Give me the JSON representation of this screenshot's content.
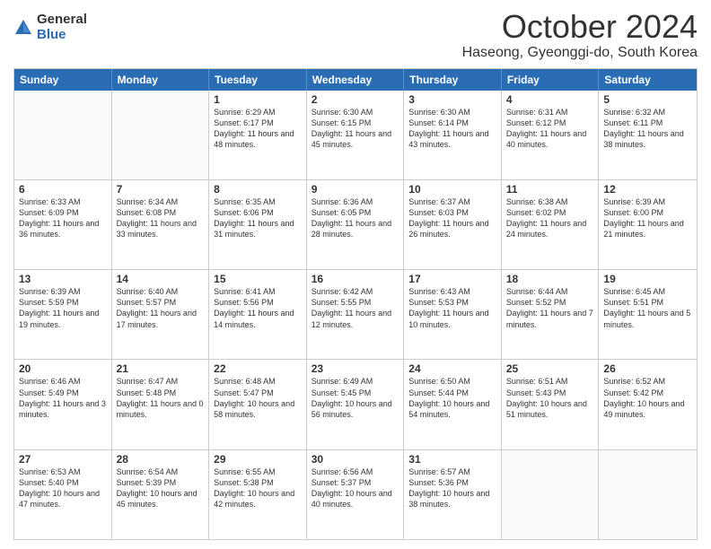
{
  "logo": {
    "general": "General",
    "blue": "Blue"
  },
  "title": "October 2024",
  "location": "Haseong, Gyeonggi-do, South Korea",
  "days_of_week": [
    "Sunday",
    "Monday",
    "Tuesday",
    "Wednesday",
    "Thursday",
    "Friday",
    "Saturday"
  ],
  "weeks": [
    [
      {
        "day": "",
        "content": ""
      },
      {
        "day": "",
        "content": ""
      },
      {
        "day": "1",
        "content": "Sunrise: 6:29 AM\nSunset: 6:17 PM\nDaylight: 11 hours and 48 minutes."
      },
      {
        "day": "2",
        "content": "Sunrise: 6:30 AM\nSunset: 6:15 PM\nDaylight: 11 hours and 45 minutes."
      },
      {
        "day": "3",
        "content": "Sunrise: 6:30 AM\nSunset: 6:14 PM\nDaylight: 11 hours and 43 minutes."
      },
      {
        "day": "4",
        "content": "Sunrise: 6:31 AM\nSunset: 6:12 PM\nDaylight: 11 hours and 40 minutes."
      },
      {
        "day": "5",
        "content": "Sunrise: 6:32 AM\nSunset: 6:11 PM\nDaylight: 11 hours and 38 minutes."
      }
    ],
    [
      {
        "day": "6",
        "content": "Sunrise: 6:33 AM\nSunset: 6:09 PM\nDaylight: 11 hours and 36 minutes."
      },
      {
        "day": "7",
        "content": "Sunrise: 6:34 AM\nSunset: 6:08 PM\nDaylight: 11 hours and 33 minutes."
      },
      {
        "day": "8",
        "content": "Sunrise: 6:35 AM\nSunset: 6:06 PM\nDaylight: 11 hours and 31 minutes."
      },
      {
        "day": "9",
        "content": "Sunrise: 6:36 AM\nSunset: 6:05 PM\nDaylight: 11 hours and 28 minutes."
      },
      {
        "day": "10",
        "content": "Sunrise: 6:37 AM\nSunset: 6:03 PM\nDaylight: 11 hours and 26 minutes."
      },
      {
        "day": "11",
        "content": "Sunrise: 6:38 AM\nSunset: 6:02 PM\nDaylight: 11 hours and 24 minutes."
      },
      {
        "day": "12",
        "content": "Sunrise: 6:39 AM\nSunset: 6:00 PM\nDaylight: 11 hours and 21 minutes."
      }
    ],
    [
      {
        "day": "13",
        "content": "Sunrise: 6:39 AM\nSunset: 5:59 PM\nDaylight: 11 hours and 19 minutes."
      },
      {
        "day": "14",
        "content": "Sunrise: 6:40 AM\nSunset: 5:57 PM\nDaylight: 11 hours and 17 minutes."
      },
      {
        "day": "15",
        "content": "Sunrise: 6:41 AM\nSunset: 5:56 PM\nDaylight: 11 hours and 14 minutes."
      },
      {
        "day": "16",
        "content": "Sunrise: 6:42 AM\nSunset: 5:55 PM\nDaylight: 11 hours and 12 minutes."
      },
      {
        "day": "17",
        "content": "Sunrise: 6:43 AM\nSunset: 5:53 PM\nDaylight: 11 hours and 10 minutes."
      },
      {
        "day": "18",
        "content": "Sunrise: 6:44 AM\nSunset: 5:52 PM\nDaylight: 11 hours and 7 minutes."
      },
      {
        "day": "19",
        "content": "Sunrise: 6:45 AM\nSunset: 5:51 PM\nDaylight: 11 hours and 5 minutes."
      }
    ],
    [
      {
        "day": "20",
        "content": "Sunrise: 6:46 AM\nSunset: 5:49 PM\nDaylight: 11 hours and 3 minutes."
      },
      {
        "day": "21",
        "content": "Sunrise: 6:47 AM\nSunset: 5:48 PM\nDaylight: 11 hours and 0 minutes."
      },
      {
        "day": "22",
        "content": "Sunrise: 6:48 AM\nSunset: 5:47 PM\nDaylight: 10 hours and 58 minutes."
      },
      {
        "day": "23",
        "content": "Sunrise: 6:49 AM\nSunset: 5:45 PM\nDaylight: 10 hours and 56 minutes."
      },
      {
        "day": "24",
        "content": "Sunrise: 6:50 AM\nSunset: 5:44 PM\nDaylight: 10 hours and 54 minutes."
      },
      {
        "day": "25",
        "content": "Sunrise: 6:51 AM\nSunset: 5:43 PM\nDaylight: 10 hours and 51 minutes."
      },
      {
        "day": "26",
        "content": "Sunrise: 6:52 AM\nSunset: 5:42 PM\nDaylight: 10 hours and 49 minutes."
      }
    ],
    [
      {
        "day": "27",
        "content": "Sunrise: 6:53 AM\nSunset: 5:40 PM\nDaylight: 10 hours and 47 minutes."
      },
      {
        "day": "28",
        "content": "Sunrise: 6:54 AM\nSunset: 5:39 PM\nDaylight: 10 hours and 45 minutes."
      },
      {
        "day": "29",
        "content": "Sunrise: 6:55 AM\nSunset: 5:38 PM\nDaylight: 10 hours and 42 minutes."
      },
      {
        "day": "30",
        "content": "Sunrise: 6:56 AM\nSunset: 5:37 PM\nDaylight: 10 hours and 40 minutes."
      },
      {
        "day": "31",
        "content": "Sunrise: 6:57 AM\nSunset: 5:36 PM\nDaylight: 10 hours and 38 minutes."
      },
      {
        "day": "",
        "content": ""
      },
      {
        "day": "",
        "content": ""
      }
    ]
  ]
}
